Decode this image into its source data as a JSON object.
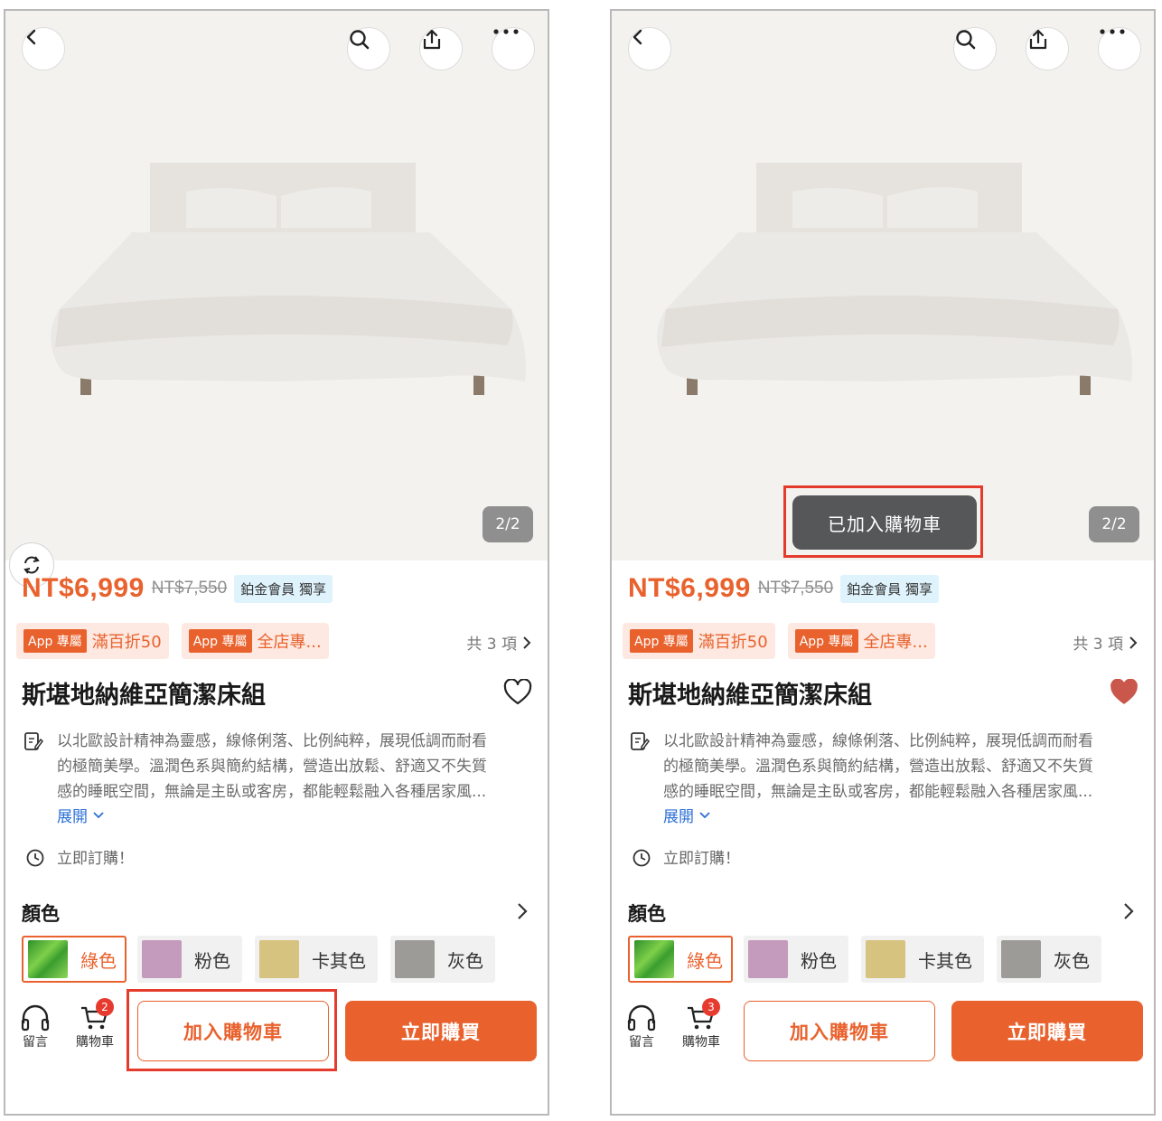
{
  "colors": {
    "accent": "#e9622e",
    "highlight": "#e53b2d",
    "link": "#2c6fd6",
    "heart_filled": "#c9574b"
  },
  "header": {
    "icons": [
      "back-icon",
      "search-icon",
      "share-icon",
      "more-icon"
    ]
  },
  "gallery": {
    "counter": "2/2"
  },
  "product": {
    "price": "NT$6,999",
    "original_price": "NT$7,550",
    "member_badge": "鉑金會員 獨享",
    "promos": [
      {
        "tag": "App 專屬",
        "text": "滿百折50"
      },
      {
        "tag": "App 專屬",
        "text": "全店專..."
      }
    ],
    "promo_total": "共 3 項",
    "title": "斯堪地納維亞簡潔床組",
    "description": "以北歐設計精神為靈感，線條俐落、比例純粹，展現低調而耐看\n的極簡美學。溫潤色系與簡約結構，營造出放鬆、舒適又不失質\n感的睡眠空間，無論是主臥或客房，都能輕鬆融入各種居家風...",
    "expand_label": "展開",
    "order_now": "立即訂購！"
  },
  "color_section": {
    "title": "顏色",
    "options": [
      {
        "label": "綠色",
        "selected": true
      },
      {
        "label": "粉色",
        "selected": false
      },
      {
        "label": "卡其色",
        "selected": false
      },
      {
        "label": "灰色",
        "selected": false
      }
    ]
  },
  "bottom_bar": {
    "chat_label": "留言",
    "cart_label": "購物車",
    "add_to_cart": "加入購物車",
    "buy_now": "立即購買"
  },
  "screens": [
    {
      "cart_count": "2",
      "favorited": false,
      "toast": ""
    },
    {
      "cart_count": "3",
      "favorited": true,
      "toast": "已加入購物車"
    }
  ]
}
